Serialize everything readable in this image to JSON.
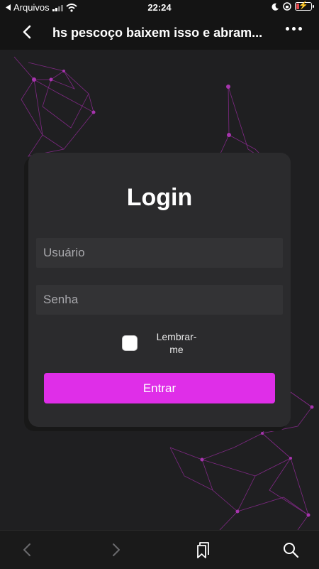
{
  "status_bar": {
    "back_app": "Arquivos",
    "time": "22:24",
    "battery_level": 0.2
  },
  "header": {
    "title": "hs pescoço baixem isso e abram..."
  },
  "login": {
    "title": "Login",
    "username_placeholder": "Usuário",
    "password_placeholder": "Senha",
    "remember_label": "Lembrar-me",
    "remember_checked": false,
    "submit_label": "Entrar"
  },
  "colors": {
    "accent": "#df2ee8",
    "background": "#1f1f21",
    "card": "#2b2b2d"
  },
  "icons": {
    "status": [
      "signal-icon",
      "wifi-icon",
      "moon-icon",
      "rotation-lock-icon",
      "battery-icon"
    ],
    "header": [
      "back-chevron-icon",
      "more-icon"
    ],
    "toolbar": [
      "chevron-left-icon",
      "chevron-right-icon",
      "bookmarks-icon",
      "search-icon"
    ]
  }
}
